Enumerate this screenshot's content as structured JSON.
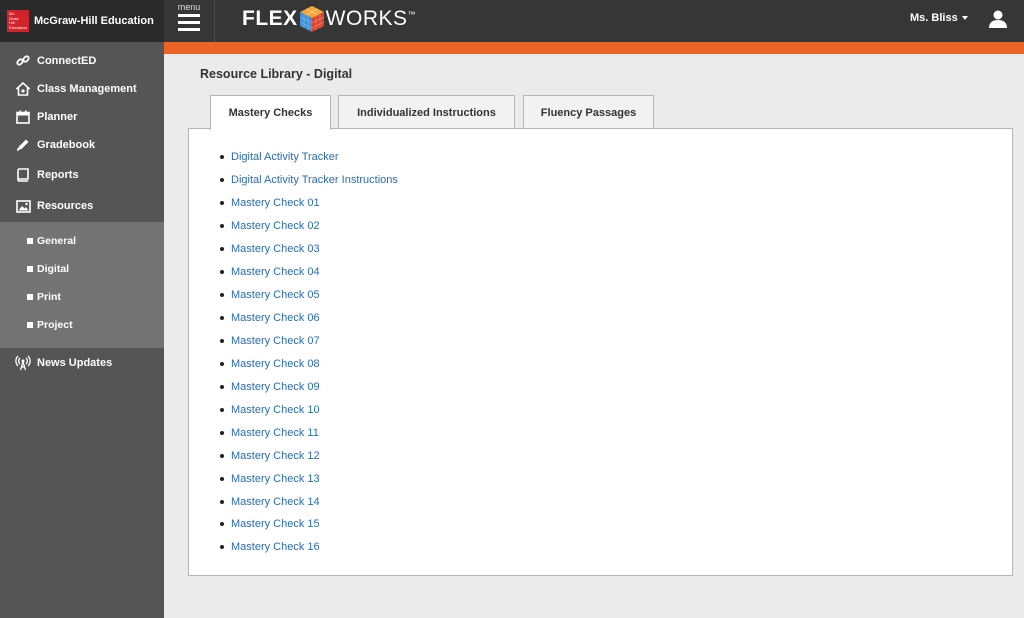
{
  "brand": {
    "logo_text": [
      "Mc",
      "Graw",
      "Hill",
      "Education"
    ],
    "name": "McGraw-Hill Education"
  },
  "header": {
    "menu_label": "menu",
    "logo_left": "FLEX",
    "logo_right": "WORKS",
    "logo_tm": "™",
    "user_name": "Ms. Bliss"
  },
  "sidebar": {
    "items": [
      {
        "label": "ConnectED",
        "icon": "link-icon"
      },
      {
        "label": "Class Management",
        "icon": "house-icon"
      },
      {
        "label": "Planner",
        "icon": "calendar-icon"
      },
      {
        "label": "Gradebook",
        "icon": "pencil-icon"
      },
      {
        "label": "Reports",
        "icon": "book-icon"
      },
      {
        "label": "Resources",
        "icon": "image-icon"
      }
    ],
    "sub_items": [
      {
        "label": "General"
      },
      {
        "label": "Digital"
      },
      {
        "label": "Print"
      },
      {
        "label": "Project"
      }
    ],
    "news": {
      "label": "News Updates",
      "icon": "broadcast-icon"
    }
  },
  "main": {
    "title": "Resource Library - Digital",
    "tabs": [
      {
        "label": "Mastery Checks",
        "active": true
      },
      {
        "label": "Individualized Instructions",
        "active": false
      },
      {
        "label": "Fluency Passages",
        "active": false
      }
    ],
    "resources": [
      "Digital Activity Tracker",
      "Digital Activity Tracker Instructions",
      "Mastery Check 01",
      "Mastery Check 02",
      "Mastery Check 03",
      "Mastery Check 04",
      "Mastery Check 05",
      "Mastery Check 06",
      "Mastery Check 07",
      "Mastery Check 08",
      "Mastery Check 09",
      "Mastery Check 10",
      "Mastery Check 11",
      "Mastery Check 12",
      "Mastery Check 13",
      "Mastery Check 14",
      "Mastery Check 15",
      "Mastery Check 16"
    ]
  },
  "colors": {
    "accent_orange": "#ec6425",
    "link_blue": "#2a6db0",
    "sidebar_bg": "#555555",
    "sidebar_sub_bg": "#737373",
    "topbar_bg": "#363636"
  }
}
